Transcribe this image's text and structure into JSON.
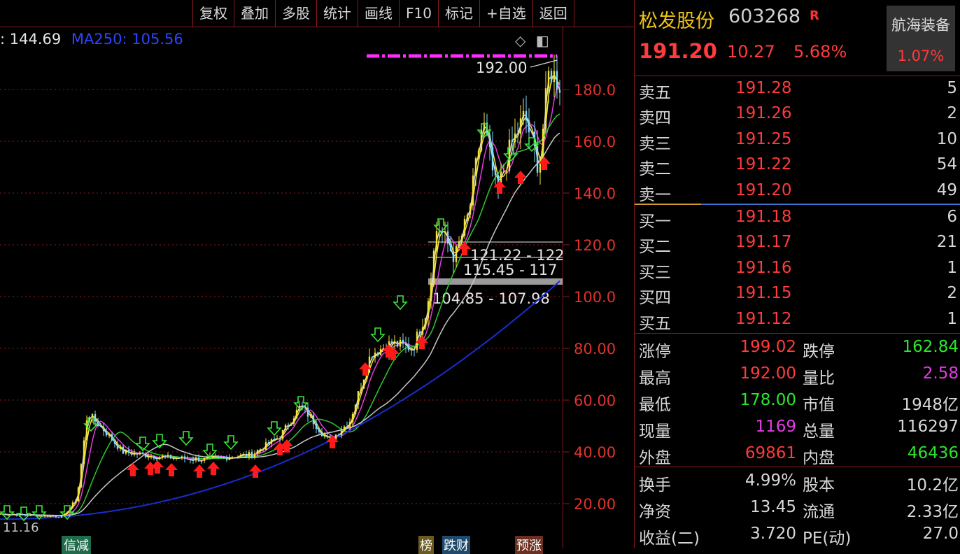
{
  "toolbar": {
    "items": [
      "复权",
      "叠加",
      "多股",
      "统计",
      "画线",
      "F10",
      "标记",
      "+自选",
      "返回"
    ]
  },
  "chart": {
    "ma_legend_1": ": 144.69",
    "ma_legend_2": "MA250: 105.56",
    "price_labels": [
      "180.0",
      "160.0",
      "140.0",
      "120.0",
      "100.0",
      "80.00",
      "60.00",
      "40.00",
      "20.00"
    ],
    "annot_high": "192.00",
    "annot_zone1": "121.22 - 122",
    "annot_zone2": "115.45 - 117",
    "annot_zone3": "104.85 - 107.98",
    "bottom_left": "11.16",
    "bottom_tag1": "信减",
    "bottom_tag2": "榜",
    "bottom_tag3": "跌财",
    "bottom_tag4": "预涨",
    "colors": {
      "axis": "#e0332b",
      "ma_white": "#dddddd",
      "ma_yellow": "#f2e33c",
      "ma_magenta": "#e23de2",
      "ma_green": "#2ec82e",
      "ma_gray": "#c8c8c8",
      "ma250": "#1a2ccf",
      "up_arrow": "#ff1a1a",
      "down_arrow": "#3be63b",
      "zone_dash": "#ff2bff"
    }
  },
  "quote": {
    "name": "松发股份",
    "code": "603268",
    "badge": "R",
    "price": "191.20",
    "change": "10.27",
    "change_pct": "5.68%",
    "sector_name": "航海装备",
    "sector_pct": "1.07%",
    "asks": [
      {
        "label": "卖五",
        "price": "191.28",
        "vol": "5"
      },
      {
        "label": "卖四",
        "price": "191.26",
        "vol": "2"
      },
      {
        "label": "卖三",
        "price": "191.25",
        "vol": "10"
      },
      {
        "label": "卖二",
        "price": "191.22",
        "vol": "54"
      },
      {
        "label": "卖一",
        "price": "191.20",
        "vol": "49"
      }
    ],
    "bids": [
      {
        "label": "买一",
        "price": "191.18",
        "vol": "6"
      },
      {
        "label": "买二",
        "price": "191.17",
        "vol": "21"
      },
      {
        "label": "买三",
        "price": "191.16",
        "vol": "1"
      },
      {
        "label": "买四",
        "price": "191.15",
        "vol": "2"
      },
      {
        "label": "买五",
        "price": "191.12",
        "vol": "1"
      }
    ],
    "stats1": [
      {
        "k1": "涨停",
        "v1": "199.02",
        "c1": "red",
        "k2": "跌停",
        "v2": "162.84",
        "c2": "green"
      },
      {
        "k1": "最高",
        "v1": "192.00",
        "c1": "red",
        "k2": "量比",
        "v2": "2.58",
        "c2": "mag"
      },
      {
        "k1": "最低",
        "v1": "178.00",
        "c1": "green",
        "k2": "市值",
        "v2": "1948亿",
        "c2": "wht"
      },
      {
        "k1": "现量",
        "v1": "1169",
        "c1": "mag",
        "k2": "总量",
        "v2": "116297",
        "c2": "wht"
      },
      {
        "k1": "外盘",
        "v1": "69861",
        "c1": "red",
        "k2": "内盘",
        "v2": "46436",
        "c2": "green"
      }
    ],
    "stats2": [
      {
        "k1": "换手",
        "v1": "4.99%",
        "c1": "wht",
        "k2": "股本",
        "v2": "10.2亿",
        "c2": "wht"
      },
      {
        "k1": "净资",
        "v1": "13.45",
        "c1": "wht",
        "k2": "流通",
        "v2": "2.33亿",
        "c2": "wht"
      },
      {
        "k1": "收益(二)",
        "v1": "3.720",
        "c1": "wht",
        "k2": "PE(动)",
        "v2": "27.0",
        "c2": "wht"
      }
    ]
  }
}
